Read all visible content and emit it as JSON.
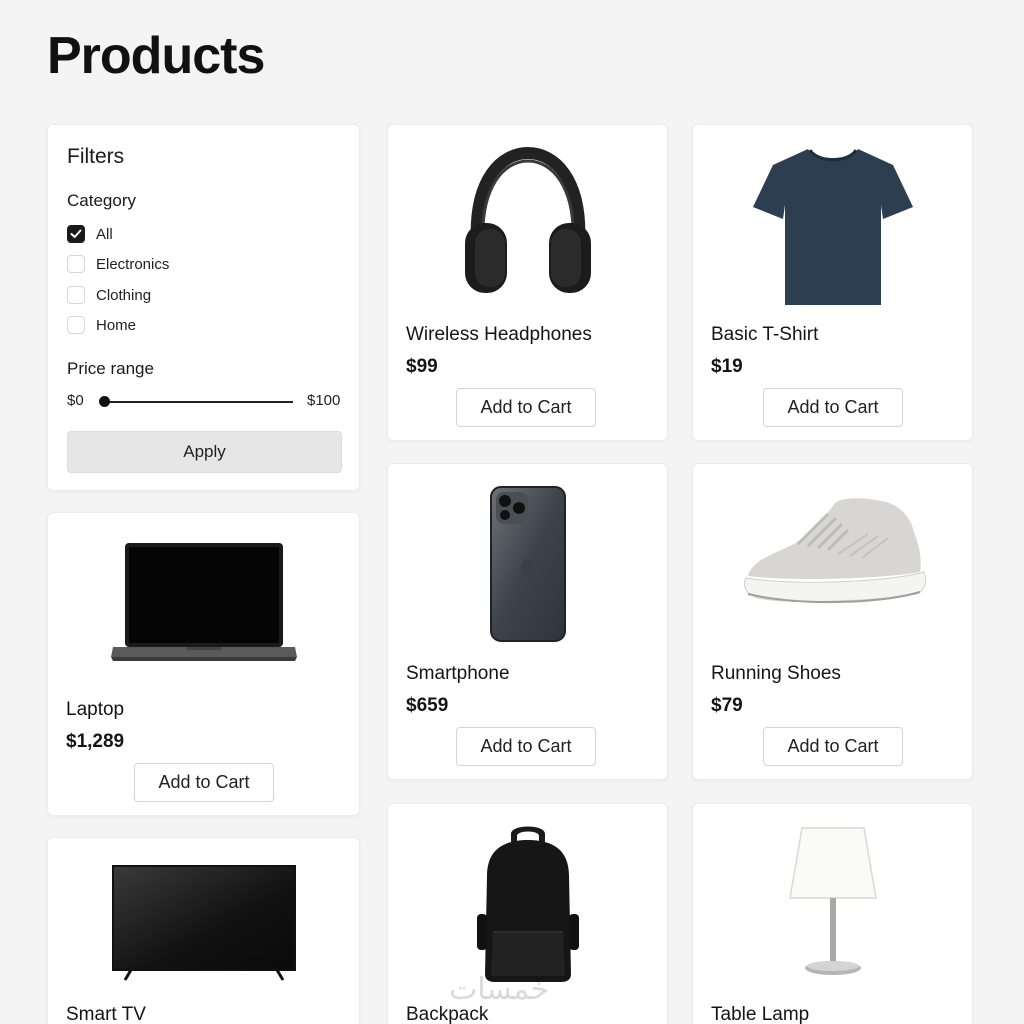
{
  "page": {
    "title": "Products"
  },
  "filters": {
    "title": "Filters",
    "category_title": "Category",
    "categories": [
      {
        "label": "All",
        "checked": true
      },
      {
        "label": "Electronics",
        "checked": false
      },
      {
        "label": "Clothing",
        "checked": false
      },
      {
        "label": "Home",
        "checked": false
      }
    ],
    "price_title": "Price range",
    "price_min": "$0",
    "price_max": "$100",
    "slider_value": 0,
    "apply_label": "Apply"
  },
  "cart_label": "Add to Cart",
  "products": [
    {
      "name": "Wireless Headphones",
      "price": "$99",
      "icon": "headphones-image"
    },
    {
      "name": "Basic T-Shirt",
      "price": "$19",
      "icon": "tshirt-image"
    },
    {
      "name": "Laptop",
      "price": "$1,289",
      "icon": "laptop-image"
    },
    {
      "name": "Smartphone",
      "price": "$659",
      "icon": "smartphone-image"
    },
    {
      "name": "Running Shoes",
      "price": "$79",
      "icon": "shoe-image"
    },
    {
      "name": "Smart TV",
      "price": "",
      "icon": "tv-image"
    },
    {
      "name": "Backpack",
      "price": "",
      "icon": "backpack-image"
    },
    {
      "name": "Table Lamp",
      "price": "",
      "icon": "lamp-image"
    }
  ],
  "watermark": "خمسات"
}
